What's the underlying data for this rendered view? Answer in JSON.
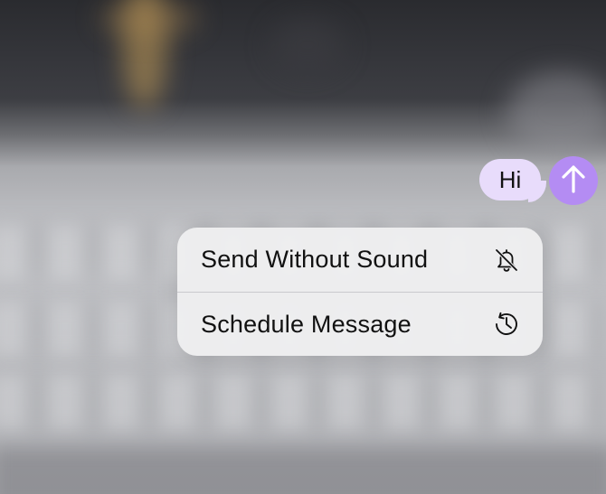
{
  "message": {
    "text": "Hi",
    "bubble_color": "#e8dcfb"
  },
  "send_button": {
    "icon": "arrow-up-icon",
    "color": "#b48cf3"
  },
  "context_menu": {
    "items": [
      {
        "label": "Send Without Sound",
        "icon": "bell-slash-icon"
      },
      {
        "label": "Schedule Message",
        "icon": "clock-arrow-icon"
      }
    ]
  }
}
